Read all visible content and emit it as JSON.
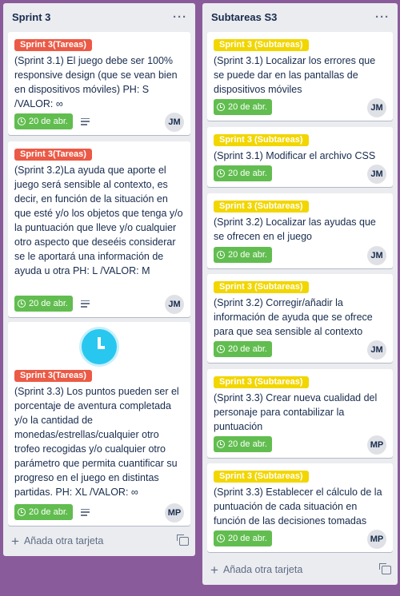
{
  "lists": [
    {
      "title": "Sprint 3",
      "menu": "···",
      "add_card": "Añada otra tarjeta",
      "cards": [
        {
          "label": "Sprint 3(Tareas)",
          "title": "(Sprint 3.1) El juego debe ser 100% responsive design (que se vean bien en dispositivos móviles) PH: S /VALOR: ∞",
          "due": "20 de abr.",
          "member": "JM"
        },
        {
          "label": "Sprint 3(Tareas)",
          "title": "(Sprint 3.2)La ayuda que aporte el juego será sensible al contexto, es decir, en función de la situación en que esté y/o los objetos que tenga y/o la puntuación que lleve y/o cualquier otro aspecto que deseéis considerar se le aportará una información de ayuda u otra PH: L /VALOR: M",
          "due": "20 de abr.",
          "member": "JM"
        },
        {
          "label": "Sprint 3(Tareas)",
          "title": "(Sprint 3.3) Los puntos pueden ser el porcentaje de aventura completada y/o la cantidad de monedas/estrellas/cualquier otro trofeo recogidas y/o cualquier otro parámetro que permita cuantificar su progreso en el juego en distintas partidas. PH: XL /VALOR: ∞",
          "due": "20 de abr.",
          "member": "MP"
        }
      ]
    },
    {
      "title": "Subtareas S3",
      "menu": "···",
      "add_card": "Añada otra tarjeta",
      "cards": [
        {
          "label": "Sprint 3 (Subtareas)",
          "title": "(Sprint 3.1) Localizar los errores que se puede dar en las pantallas de dispositivos móviles",
          "due": "20 de abr.",
          "member": "JM"
        },
        {
          "label": "Sprint 3 (Subtareas)",
          "title": "(Sprint 3.1) Modificar el archivo CSS",
          "due": "20 de abr.",
          "member": "JM"
        },
        {
          "label": "Sprint 3 (Subtareas)",
          "title": "(Sprint 3.2) Localizar las ayudas que se ofrecen en el juego",
          "due": "20 de abr.",
          "member": "JM"
        },
        {
          "label": "Sprint 3 (Subtareas)",
          "title": "(Sprint 3.2) Corregir/añadir la información de ayuda que se ofrece para que sea sensible al contexto",
          "due": "20 de abr.",
          "member": "JM"
        },
        {
          "label": "Sprint 3 (Subtareas)",
          "title": "(Sprint 3.3) Crear nueva cualidad del personaje para contabilizar la puntuación",
          "due": "20 de abr.",
          "member": "MP"
        },
        {
          "label": "Sprint 3 (Subtareas)",
          "title": "(Sprint 3.3) Establecer el cálculo de la puntuación de cada situación en función de las decisiones tomadas",
          "due": "20 de abr.",
          "member": "MP"
        }
      ]
    }
  ],
  "colors": {
    "board_bg": "#8a5b9a",
    "label_red": "#eb5a46",
    "label_yellow": "#f2d600",
    "due_green": "#61bd4f"
  }
}
